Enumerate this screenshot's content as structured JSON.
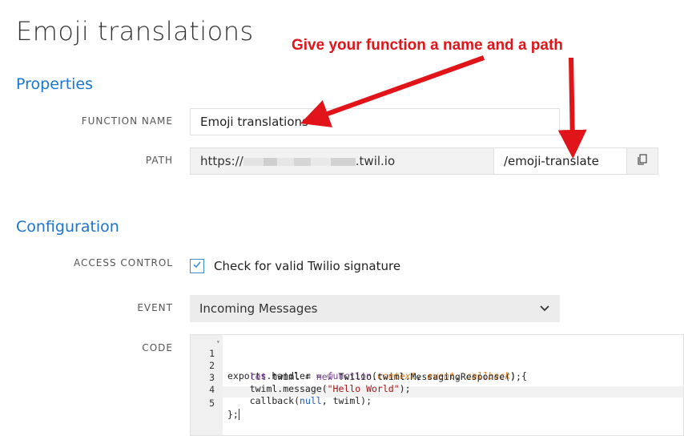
{
  "page": {
    "title": "Emoji translations"
  },
  "annotation": {
    "text": "Give your function a name and a path"
  },
  "properties": {
    "section_title": "Properties",
    "function_name": {
      "label": "FUNCTION NAME",
      "value": "Emoji translations"
    },
    "path": {
      "label": "PATH",
      "prefix": "https://",
      "suffix": ".twil.io",
      "value": "/emoji-translate",
      "copy_icon": "copy-icon"
    }
  },
  "configuration": {
    "section_title": "Configuration",
    "access_control": {
      "label": "ACCESS CONTROL",
      "checkbox_label": "Check for valid Twilio signature",
      "checked": true
    },
    "event": {
      "label": "EVENT",
      "selected": "Incoming Messages",
      "icon": "chevron-down-icon"
    },
    "code": {
      "label": "CODE",
      "line_numbers": [
        "1",
        "2",
        "3",
        "4",
        "5"
      ],
      "lines": [
        "exports.handler = function(context, event, callback) {",
        "    let twiml = new Twilio.twiml.MessagingResponse();",
        "    twiml.message(\"Hello World\");",
        "    callback(null, twiml);",
        "};"
      ]
    }
  },
  "colors": {
    "accent": "#1a75d2",
    "annotation": "#e1141a",
    "checkbox": "#3a8ed6"
  }
}
